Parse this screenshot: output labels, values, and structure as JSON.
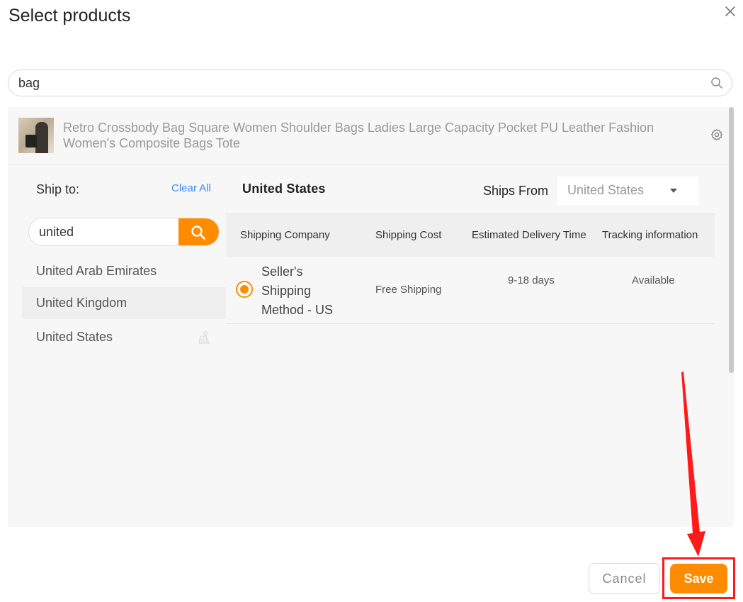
{
  "dialog": {
    "title": "Select products",
    "close_icon": "close-icon"
  },
  "search": {
    "value": "bag",
    "icon": "search-icon"
  },
  "product": {
    "title": "Retro Crossbody Bag Square Women Shoulder Bags Ladies Large Capacity Pocket PU Leather Fashion Women's Composite Bags Tote",
    "settings_icon": "gear-icon"
  },
  "ship_to": {
    "label": "Ship to:",
    "clear_all": "Clear All",
    "search_value": "united",
    "countries": [
      {
        "name": "United Arab Emirates"
      },
      {
        "name": "United Kingdom"
      },
      {
        "name": "United States"
      }
    ]
  },
  "shipping": {
    "country": "United States",
    "ships_from_label": "Ships From",
    "ships_from_value": "United States",
    "columns": [
      "Shipping Company",
      "Shipping Cost",
      "Estimated Delivery Time",
      "Tracking information"
    ],
    "rows": [
      {
        "company": "Seller's Shipping Method - US",
        "cost": "Free Shipping",
        "delivery": "9-18 days",
        "tracking": "Available",
        "selected": true
      }
    ]
  },
  "footer": {
    "cancel_label": "Cancel",
    "save_label": "Save"
  },
  "colors": {
    "accent": "#ff8c00",
    "link": "#3d8af7",
    "highlight": "#ff1a1a"
  }
}
